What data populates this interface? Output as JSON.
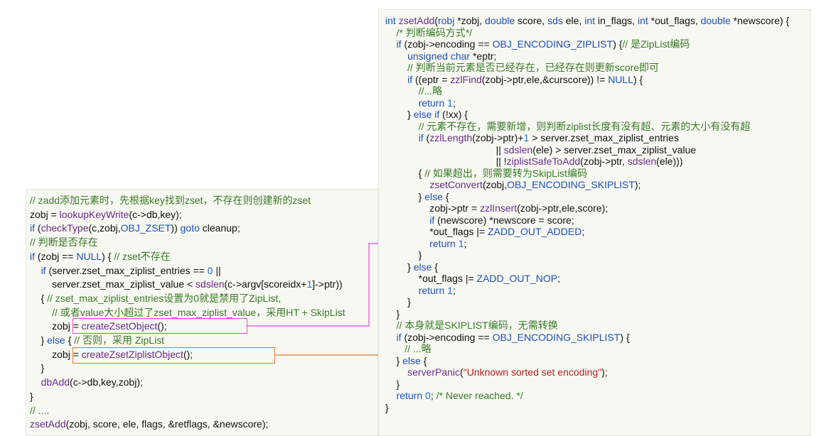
{
  "left_panel": {
    "lines": [
      [
        [
          "cm",
          "// zadd添加元素时，先根据key找到zset，不存在则创建新的zset"
        ]
      ],
      [
        [
          "id",
          "zobj = "
        ],
        [
          "fn",
          "lookupKeyWrite"
        ],
        [
          "id",
          "(c->db,key);"
        ]
      ],
      [
        [
          "kw",
          "if"
        ],
        [
          "id",
          " ("
        ],
        [
          "fn",
          "checkType"
        ],
        [
          "id",
          "(c,zobj,"
        ],
        [
          "kw",
          "OBJ_ZSET"
        ],
        [
          "id",
          ")) "
        ],
        [
          "kw",
          "goto"
        ],
        [
          "id",
          " cleanup;"
        ]
      ],
      [
        [
          "cm",
          "// 判断是否存在"
        ]
      ],
      [
        [
          "kw",
          "if"
        ],
        [
          "id",
          " (zobj == "
        ],
        [
          "kw",
          "NULL"
        ],
        [
          "id",
          ") { "
        ],
        [
          "cm",
          "// zset不存在"
        ]
      ],
      [
        [
          "id",
          "    "
        ],
        [
          "kw",
          "if"
        ],
        [
          "id",
          " (server.zset_max_ziplist_entries == "
        ],
        [
          "num",
          "0"
        ],
        [
          "id",
          " ||"
        ]
      ],
      [
        [
          "id",
          "        server.zset_max_ziplist_value < "
        ],
        [
          "fn",
          "sdslen"
        ],
        [
          "id",
          "(c->argv[scoreidx+"
        ],
        [
          "num",
          "1"
        ],
        [
          "id",
          "]->ptr))"
        ]
      ],
      [
        [
          "id",
          "    { "
        ],
        [
          "cm",
          "// zset_max_ziplist_entries设置为0就是禁用了ZipList,"
        ]
      ],
      [
        [
          "cm",
          "        // 或者value大小超过了zset_max_ziplist_value，采用HT + SkipList"
        ]
      ],
      [
        [
          "id",
          "        zobj = "
        ],
        [
          "fn",
          "createZsetObject"
        ],
        [
          "id",
          "();"
        ]
      ],
      [
        [
          "id",
          "    } "
        ],
        [
          "kw",
          "else"
        ],
        [
          "id",
          " { "
        ],
        [
          "cm",
          "// 否则，采用 ZipList"
        ]
      ],
      [
        [
          "id",
          "        zobj = "
        ],
        [
          "fn",
          "createZsetZiplistObject"
        ],
        [
          "id",
          "();"
        ]
      ],
      [
        [
          "id",
          "    }"
        ]
      ],
      [
        [
          "id",
          "    "
        ],
        [
          "fn",
          "dbAdd"
        ],
        [
          "id",
          "(c->db,key,zobj);"
        ]
      ],
      [
        [
          "id",
          "}"
        ]
      ],
      [
        [
          "cm",
          "// ...."
        ]
      ],
      [
        [
          "fn",
          "zsetAdd"
        ],
        [
          "id",
          "(zobj, score, ele, flags, &retflags, &newscore);"
        ]
      ]
    ]
  },
  "right_panel": {
    "lines": [
      [
        [
          "ty",
          "int"
        ],
        [
          "id",
          " "
        ],
        [
          "fn",
          "zsetAdd"
        ],
        [
          "id",
          "("
        ],
        [
          "ty",
          "robj"
        ],
        [
          "id",
          " *zobj, "
        ],
        [
          "ty",
          "double"
        ],
        [
          "id",
          " score, "
        ],
        [
          "ty",
          "sds"
        ],
        [
          "id",
          " ele, "
        ],
        [
          "ty",
          "int"
        ],
        [
          "id",
          " in_flags, "
        ],
        [
          "ty",
          "int"
        ],
        [
          "id",
          " *out_flags, "
        ],
        [
          "ty",
          "double"
        ],
        [
          "id",
          " *newscore) {"
        ]
      ],
      [
        [
          "id",
          "    "
        ],
        [
          "cm",
          "/* 判断编码方式*/"
        ]
      ],
      [
        [
          "id",
          "    "
        ],
        [
          "kw",
          "if"
        ],
        [
          "id",
          " (zobj->encoding == "
        ],
        [
          "kw",
          "OBJ_ENCODING_ZIPLIST"
        ],
        [
          "id",
          ") {"
        ],
        [
          "cm",
          "// 是ZipList编码"
        ]
      ],
      [
        [
          "id",
          "        "
        ],
        [
          "ty",
          "unsigned char"
        ],
        [
          "id",
          " *eptr;"
        ]
      ],
      [
        [
          "id",
          "        "
        ],
        [
          "cm",
          "// 判断当前元素是否已经存在，已经存在则更新score即可"
        ]
      ],
      [
        [
          "id",
          "        "
        ],
        [
          "kw",
          "if"
        ],
        [
          "id",
          " ((eptr = "
        ],
        [
          "fn",
          "zzlFind"
        ],
        [
          "id",
          "(zobj->ptr,ele,&curscore)) != "
        ],
        [
          "kw",
          "NULL"
        ],
        [
          "id",
          ") {"
        ]
      ],
      [
        [
          "id",
          "            "
        ],
        [
          "cm",
          "//...略"
        ]
      ],
      [
        [
          "id",
          "            "
        ],
        [
          "kw",
          "return"
        ],
        [
          "id",
          " "
        ],
        [
          "num",
          "1"
        ],
        [
          "id",
          ";"
        ]
      ],
      [
        [
          "id",
          "        } "
        ],
        [
          "kw",
          "else if"
        ],
        [
          "id",
          " (!xx) {"
        ]
      ],
      [
        [
          "id",
          "            "
        ],
        [
          "cm",
          "// 元素不存在，需要新增，则判断ziplist长度有没有超、元素的大小有没有超"
        ]
      ],
      [
        [
          "id",
          "            "
        ],
        [
          "kw",
          "if"
        ],
        [
          "id",
          " ("
        ],
        [
          "fn",
          "zzlLength"
        ],
        [
          "id",
          "(zobj->ptr)+"
        ],
        [
          "num",
          "1"
        ],
        [
          "id",
          " > server.zset_max_ziplist_entries"
        ]
      ],
      [
        [
          "id",
          "                                        || "
        ],
        [
          "fn",
          "sdslen"
        ],
        [
          "id",
          "(ele) > server.zset_max_ziplist_value"
        ]
      ],
      [
        [
          "id",
          "                                        || !"
        ],
        [
          "fn",
          "ziplistSafeToAdd"
        ],
        [
          "id",
          "(zobj->ptr, "
        ],
        [
          "fn",
          "sdslen"
        ],
        [
          "id",
          "(ele)))"
        ]
      ],
      [
        [
          "id",
          "            { "
        ],
        [
          "cm",
          "// 如果超出，则需要转为SkipList编码"
        ]
      ],
      [
        [
          "id",
          "                "
        ],
        [
          "fn",
          "zsetConvert"
        ],
        [
          "id",
          "(zobj,"
        ],
        [
          "kw",
          "OBJ_ENCODING_SKIPLIST"
        ],
        [
          "id",
          ");"
        ]
      ],
      [
        [
          "id",
          "            } "
        ],
        [
          "kw",
          "else"
        ],
        [
          "id",
          " {"
        ]
      ],
      [
        [
          "id",
          "                zobj->ptr = "
        ],
        [
          "fn",
          "zzlInsert"
        ],
        [
          "id",
          "(zobj->ptr,ele,score);"
        ]
      ],
      [
        [
          "id",
          "                "
        ],
        [
          "kw",
          "if"
        ],
        [
          "id",
          " (newscore) *newscore = score;"
        ]
      ],
      [
        [
          "id",
          "                *out_flags |= "
        ],
        [
          "kw",
          "ZADD_OUT_ADDED"
        ],
        [
          "id",
          ";"
        ]
      ],
      [
        [
          "id",
          "                "
        ],
        [
          "kw",
          "return"
        ],
        [
          "id",
          " "
        ],
        [
          "num",
          "1"
        ],
        [
          "id",
          ";"
        ]
      ],
      [
        [
          "id",
          "            }"
        ]
      ],
      [
        [
          "id",
          "        } "
        ],
        [
          "kw",
          "else"
        ],
        [
          "id",
          " {"
        ]
      ],
      [
        [
          "id",
          "            *out_flags |= "
        ],
        [
          "kw",
          "ZADD_OUT_NOP"
        ],
        [
          "id",
          ";"
        ]
      ],
      [
        [
          "id",
          "            "
        ],
        [
          "kw",
          "return"
        ],
        [
          "id",
          " "
        ],
        [
          "num",
          "1"
        ],
        [
          "id",
          ";"
        ]
      ],
      [
        [
          "id",
          "        }"
        ]
      ],
      [
        [
          "id",
          "    }"
        ]
      ],
      [
        [
          "id",
          "    "
        ],
        [
          "cm",
          "// 本身就是SKIPLIST编码，无需转换"
        ]
      ],
      [
        [
          "id",
          "    "
        ],
        [
          "kw",
          "if"
        ],
        [
          "id",
          " (zobj->encoding == "
        ],
        [
          "kw",
          "OBJ_ENCODING_SKIPLIST"
        ],
        [
          "id",
          ") {"
        ]
      ],
      [
        [
          "id",
          "       "
        ],
        [
          "cm",
          "// ...略"
        ]
      ],
      [
        [
          "id",
          "    } "
        ],
        [
          "kw",
          "else"
        ],
        [
          "id",
          " {"
        ]
      ],
      [
        [
          "id",
          "        "
        ],
        [
          "fn",
          "serverPanic"
        ],
        [
          "id",
          "("
        ],
        [
          "str",
          "\"Unknown sorted set encoding\""
        ],
        [
          "id",
          ");"
        ]
      ],
      [
        [
          "id",
          "    }"
        ]
      ],
      [
        [
          "id",
          "    "
        ],
        [
          "kw",
          "return"
        ],
        [
          "id",
          " "
        ],
        [
          "num",
          "0"
        ],
        [
          "id",
          "; "
        ],
        [
          "cm",
          "/* Never reached. */"
        ]
      ],
      [
        [
          "id",
          "}"
        ]
      ]
    ]
  },
  "colors": {
    "panel_bg": "#f7f8f1",
    "keyword": "#1e4fb8",
    "comment": "#3a7a2a",
    "function": "#6a2b8c",
    "number": "#1c6fd1",
    "pink_highlight": "#e64ad8",
    "orange_highlight": "#e07a2e"
  }
}
